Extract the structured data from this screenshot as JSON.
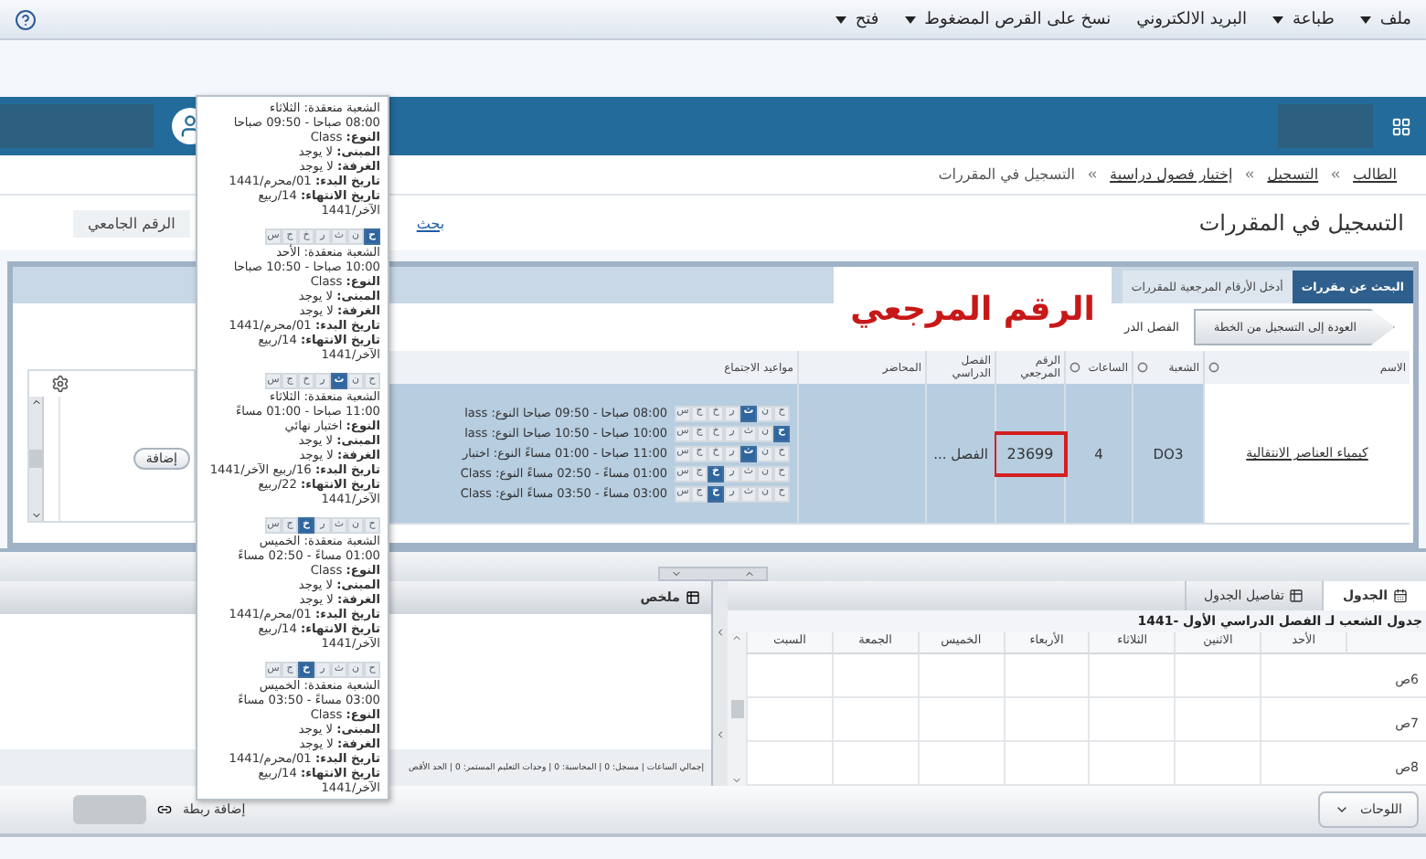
{
  "menu_bar": {
    "items": [
      {
        "label": "ملف",
        "dropdown": true
      },
      {
        "label": "طباعة",
        "dropdown": true
      },
      {
        "label": "البريد الالكتروني",
        "dropdown": false
      },
      {
        "label": "نسخ على القرص المضغوط",
        "dropdown": true
      },
      {
        "label": "فتح",
        "dropdown": true
      }
    ]
  },
  "breadcrumb": [
    "الطالب",
    "التسجيل",
    "إختيار فصول دراسية",
    "التسجيل في المقررات"
  ],
  "page_title": "التسجيل في المقررات",
  "search_link": "بحث",
  "student_id_label": "الرقم الجامعي",
  "tabs": [
    {
      "label": "البحث عن مقررات",
      "selected": true
    },
    {
      "label": "أدخل الأرقام المرجعية للمقررات",
      "selected": false
    }
  ],
  "back_button": "العودة إلى التسجيل من الخطة",
  "term_label": "الفصل الدر",
  "annotation": "الرقم المرجعي",
  "add_button": "إضافة",
  "courses": {
    "columns": [
      "الاسم",
      "الشعبة",
      "الساعات",
      "الرقم المرجعي",
      "الفصل الدراسي",
      "المحاضر",
      "مواعيد الاجتماع"
    ],
    "rows": [
      {
        "name": "كيمياء العناصر الانتقالية",
        "section": "DO3",
        "hours": "4",
        "crn": "23699",
        "crn_highlighted": true,
        "term": "الفصل ...",
        "meetings": [
          {
            "text": "08:00 صباحا - 09:50 صباحا النوع: lass",
            "days": [
              {
                "label": "ح",
                "selected": false
              },
              {
                "label": "ن",
                "selected": false
              },
              {
                "label": "ث",
                "selected": true
              },
              {
                "label": "ر",
                "selected": false
              },
              {
                "label": "خ",
                "selected": false
              },
              {
                "label": "ج",
                "selected": false
              },
              {
                "label": "س",
                "selected": false
              }
            ]
          },
          {
            "text": "10:00 صباحا - 10:50 صباحا النوع: lass",
            "days": [
              {
                "label": "ح",
                "selected": true
              },
              {
                "label": "ن",
                "selected": false
              },
              {
                "label": "ث",
                "selected": false
              },
              {
                "label": "ر",
                "selected": false
              },
              {
                "label": "خ",
                "selected": false
              },
              {
                "label": "ج",
                "selected": false
              },
              {
                "label": "س",
                "selected": false
              }
            ]
          },
          {
            "text": "11:00 صباحا - 01:00 مساءً النوع: اختبار",
            "days": [
              {
                "label": "ح",
                "selected": false
              },
              {
                "label": "ن",
                "selected": false
              },
              {
                "label": "ث",
                "selected": true
              },
              {
                "label": "ر",
                "selected": false
              },
              {
                "label": "خ",
                "selected": false
              },
              {
                "label": "ج",
                "selected": false
              },
              {
                "label": "س",
                "selected": false
              }
            ]
          },
          {
            "text": "01:00 مساءً - 02:50 مساءً النوع: Class",
            "days": [
              {
                "label": "ح",
                "selected": false
              },
              {
                "label": "ن",
                "selected": false
              },
              {
                "label": "ث",
                "selected": false
              },
              {
                "label": "ر",
                "selected": false
              },
              {
                "label": "خ",
                "selected": true
              },
              {
                "label": "ج",
                "selected": false
              },
              {
                "label": "س",
                "selected": false
              }
            ]
          },
          {
            "text": "03:00 مساءً - 03:50 مساءً النوع: Class",
            "days": [
              {
                "label": "ح",
                "selected": false
              },
              {
                "label": "ن",
                "selected": false
              },
              {
                "label": "ث",
                "selected": false
              },
              {
                "label": "ر",
                "selected": false
              },
              {
                "label": "خ",
                "selected": true
              },
              {
                "label": "ج",
                "selected": false
              },
              {
                "label": "س",
                "selected": false
              }
            ]
          }
        ]
      }
    ]
  },
  "tooltip": {
    "blocks": [
      {
        "lines": [
          "الشعبة منعقدة: الثلاثاء",
          "08:00 صباحا - 09:50 صباحا",
          "**النوع:** Class",
          "**المبنى:** لا يوجد",
          "**الغرفة:** لا يوجد",
          "**تاريخ البدء:** 01/محرم/1441",
          "**تاريخ الانتهاء:** 14/ربيع",
          "الآخر/1441"
        ]
      },
      {
        "days": [
          {
            "label": "ح",
            "selected": true
          },
          {
            "label": "ن",
            "selected": false
          },
          {
            "label": "ث",
            "selected": false
          },
          {
            "label": "ر",
            "selected": false
          },
          {
            "label": "خ",
            "selected": false
          },
          {
            "label": "ج",
            "selected": false
          },
          {
            "label": "س",
            "selected": false
          }
        ],
        "lines": [
          "الشعبة منعقدة: الأحد",
          "10:00 صباحا - 10:50 صباحا",
          "**النوع:** Class",
          "**المبنى:** لا يوجد",
          "**الغرفة:** لا يوجد",
          "**تاريخ البدء:** 01/محرم/1441",
          "**تاريخ الانتهاء:** 14/ربيع",
          "الآخر/1441"
        ]
      },
      {
        "days": [
          {
            "label": "ح",
            "selected": false
          },
          {
            "label": "ن",
            "selected": false
          },
          {
            "label": "ث",
            "selected": true
          },
          {
            "label": "ر",
            "selected": false
          },
          {
            "label": "خ",
            "selected": false
          },
          {
            "label": "ج",
            "selected": false
          },
          {
            "label": "س",
            "selected": false
          }
        ],
        "lines": [
          "الشعبة منعقدة: الثلاثاء",
          "11:00 صباحا - 01:00 مساءً",
          "**النوع:** اختبار نهائي",
          "**المبنى:** لا يوجد",
          "**الغرفة:** لا يوجد",
          "**تاريخ البدء:** 16/ربيع الآخر/1441",
          "**تاريخ الانتهاء:** 22/ربيع",
          "الآخر/1441"
        ]
      },
      {
        "days": [
          {
            "label": "ح",
            "selected": false
          },
          {
            "label": "ن",
            "selected": false
          },
          {
            "label": "ث",
            "selected": false
          },
          {
            "label": "ر",
            "selected": false
          },
          {
            "label": "خ",
            "selected": true
          },
          {
            "label": "ج",
            "selected": false
          },
          {
            "label": "س",
            "selected": false
          }
        ],
        "lines": [
          "الشعبة منعقدة: الخميس",
          "01:00 مساءً - 02:50 مساءً",
          "**النوع:** Class",
          "**المبنى:** لا يوجد",
          "**الغرفة:** لا يوجد",
          "**تاريخ البدء:** 01/محرم/1441",
          "**تاريخ الانتهاء:** 14/ربيع",
          "الآخر/1441"
        ]
      },
      {
        "days": [
          {
            "label": "ح",
            "selected": false
          },
          {
            "label": "ن",
            "selected": false
          },
          {
            "label": "ث",
            "selected": false
          },
          {
            "label": "ر",
            "selected": false
          },
          {
            "label": "خ",
            "selected": true
          },
          {
            "label": "ج",
            "selected": false
          },
          {
            "label": "س",
            "selected": false
          }
        ],
        "lines": [
          "الشعبة منعقدة: الخميس",
          "03:00 مساءً - 03:50 مساءً",
          "**النوع:** Class",
          "**المبنى:** لا يوجد",
          "**الغرفة:** لا يوجد",
          "**تاريخ البدء:** 01/محرم/1441",
          "**تاريخ الانتهاء:** 14/ربيع",
          "الآخر/1441"
        ]
      }
    ]
  },
  "schedule": {
    "tabs": [
      {
        "label": "الجدول",
        "selected": true
      },
      {
        "label": "تفاصيل الجدول",
        "selected": false
      }
    ],
    "title": "جدول الشعب لـ الفصل الدراسي الأول -1441",
    "days": [
      "الأحد",
      "الاثنين",
      "الثلاثاء",
      "الأربعاء",
      "الخميس",
      "الجمعة",
      "السبت"
    ],
    "hours": [
      "6ص",
      "7ص",
      "8ص"
    ]
  },
  "summary": {
    "title": "ملخص",
    "footer": "إجمالي الساعات | مسجل: 0 | المحاسبة: 0 | وحدات التعليم المستمر: 0 | الحد الأقص"
  },
  "bottom_bar": {
    "panels_button": "اللوحات",
    "link": "إضافة ربطة"
  }
}
